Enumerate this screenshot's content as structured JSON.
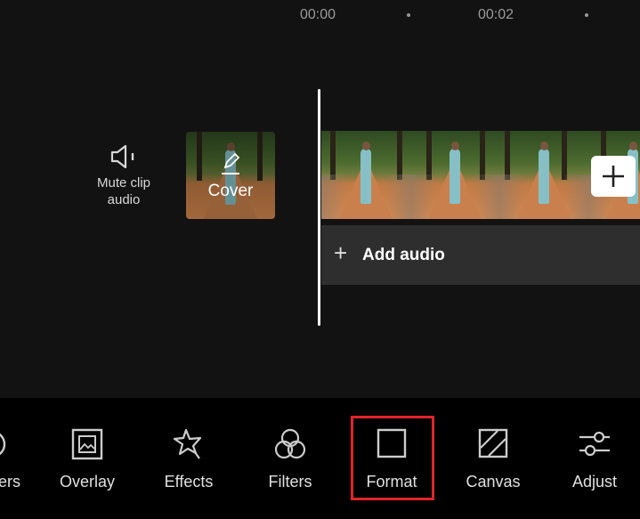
{
  "timeline": {
    "ticks": [
      "00:00",
      "00:02"
    ]
  },
  "left_panel": {
    "mute_label": "Mute clip audio",
    "cover_label": "Cover"
  },
  "track": {
    "add_audio_label": "Add audio",
    "frame_count": 4
  },
  "toolbar": {
    "items": [
      {
        "label": "Stickers",
        "visible_label": "ers",
        "icon": "sticker-icon"
      },
      {
        "label": "Overlay",
        "icon": "overlay-icon"
      },
      {
        "label": "Effects",
        "icon": "effects-star-icon"
      },
      {
        "label": "Filters",
        "icon": "filters-icon"
      },
      {
        "label": "Format",
        "icon": "format-icon",
        "highlighted": true
      },
      {
        "label": "Canvas",
        "icon": "canvas-icon"
      },
      {
        "label": "Adjust",
        "icon": "adjust-sliders-icon"
      }
    ]
  },
  "colors": {
    "highlight": "#e0242b",
    "background": "#121212",
    "toolbar": "#000000"
  }
}
